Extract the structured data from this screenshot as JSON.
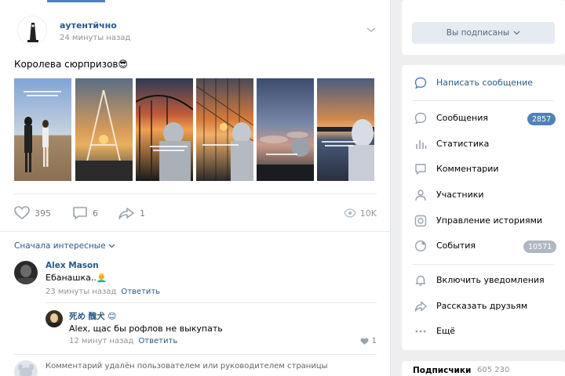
{
  "post": {
    "author": "аутентйчно",
    "time": "24 минуты назад",
    "text": "Королева сюрпризов😎",
    "photos": [
      {
        "caption": "",
        "icon": "photo-girls-beach"
      },
      {
        "caption": "",
        "icon": "photo-sunset-tent"
      },
      {
        "caption": "",
        "icon": "photo-bridge-sunset"
      },
      {
        "caption": "",
        "icon": "photo-fence-sunset"
      },
      {
        "caption": "",
        "icon": "photo-clouds"
      },
      {
        "caption": "",
        "icon": "photo-river-hood"
      }
    ],
    "likes": "395",
    "comments": "6",
    "shares": "1",
    "views": "10K"
  },
  "comments_section": {
    "sort_label": "Сначала интересные",
    "comments": [
      {
        "author": "Alex Mason",
        "text": "Ебанашка..👨‍🦲",
        "time": "23 минуты назад",
        "reply": "Ответить"
      },
      {
        "author": "死め 醜犬 😊",
        "text": "Alex, щас бы рофлов не выкупать",
        "time": "12 минут назад",
        "reply": "Ответить",
        "likes": "1"
      },
      {
        "text": "Комментарий удалён пользователем или руководителем страницы"
      }
    ]
  },
  "sidebar": {
    "subscribe_button": "Вы подписаны",
    "menu": [
      {
        "label": "Написать сообщение",
        "icon": "message-icon"
      },
      {
        "label": "Сообщения",
        "icon": "chat-icon",
        "badge": "2857"
      },
      {
        "label": "Статистика",
        "icon": "stats-icon"
      },
      {
        "label": "Комментарии",
        "icon": "comment-icon"
      },
      {
        "label": "Участники",
        "icon": "user-icon"
      },
      {
        "label": "Управление историями",
        "icon": "stories-icon"
      },
      {
        "label": "События",
        "icon": "events-icon",
        "badge": "10571"
      },
      {
        "label": "Включить уведомления",
        "icon": "bell-icon"
      },
      {
        "label": "Рассказать друзьям",
        "icon": "share-icon"
      },
      {
        "label": "Ещё",
        "icon": "more-icon"
      }
    ],
    "followers_label": "Подписчики",
    "followers_count": "605 230"
  },
  "colors": {
    "link": "#2a5885",
    "badge_blue": "#5181b8",
    "badge_grey": "#aeb7c2",
    "background": "#edeef0"
  }
}
